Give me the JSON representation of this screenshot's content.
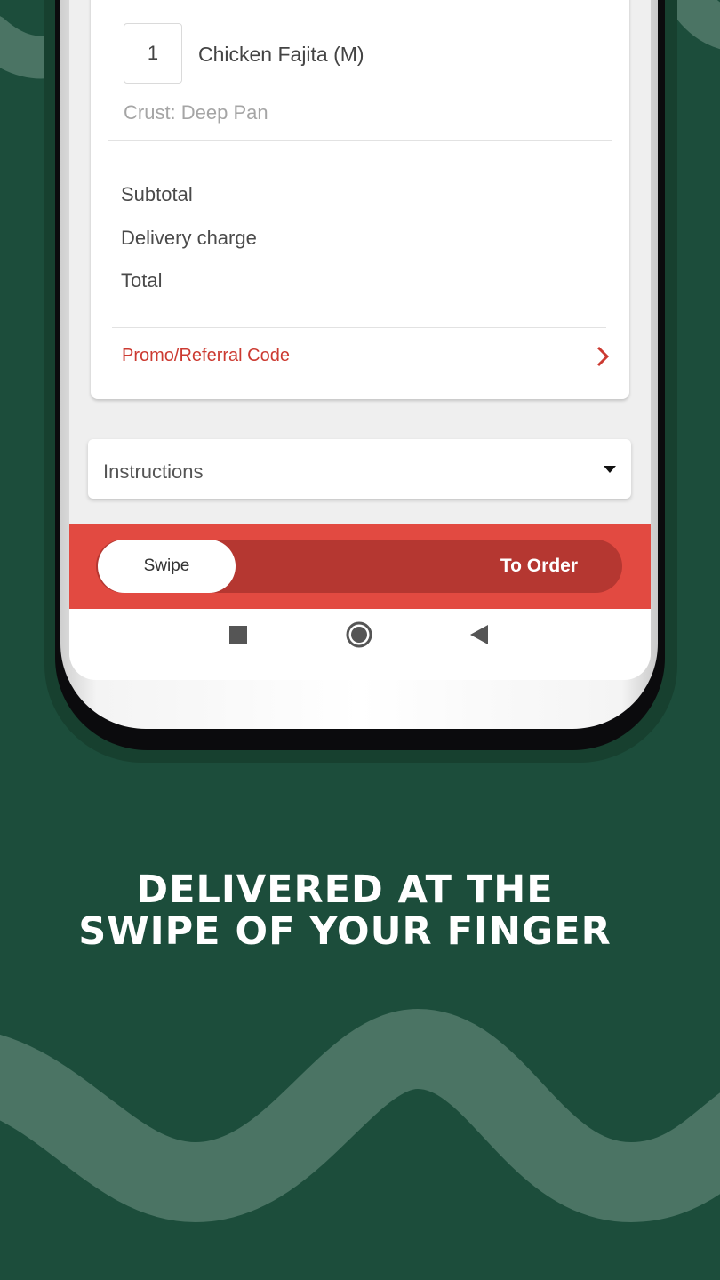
{
  "order": {
    "item": {
      "quantity": "1",
      "name": "Chicken Fajita (M)",
      "crust": "Crust: Deep Pan"
    },
    "summary": {
      "subtotal_label": "Subtotal",
      "delivery_label": "Delivery charge",
      "total_label": "Total"
    },
    "promo_label": "Promo/Referral Code"
  },
  "instructions": {
    "label": "Instructions"
  },
  "swipe": {
    "knob_label": "Swipe",
    "target_label": "To Order"
  },
  "navbar": {
    "icons": [
      "recents-square-icon",
      "home-circle-icon",
      "back-triangle-icon"
    ]
  },
  "tagline": {
    "line1": "DELIVERED AT THE",
    "line2": "SWIPE OF YOUR FINGER"
  },
  "colors": {
    "background": "#1c4d3b",
    "accent_red": "#e24a41",
    "track_red": "#b53731",
    "promo_red": "#cc3a31",
    "wave": "#4b7464"
  }
}
